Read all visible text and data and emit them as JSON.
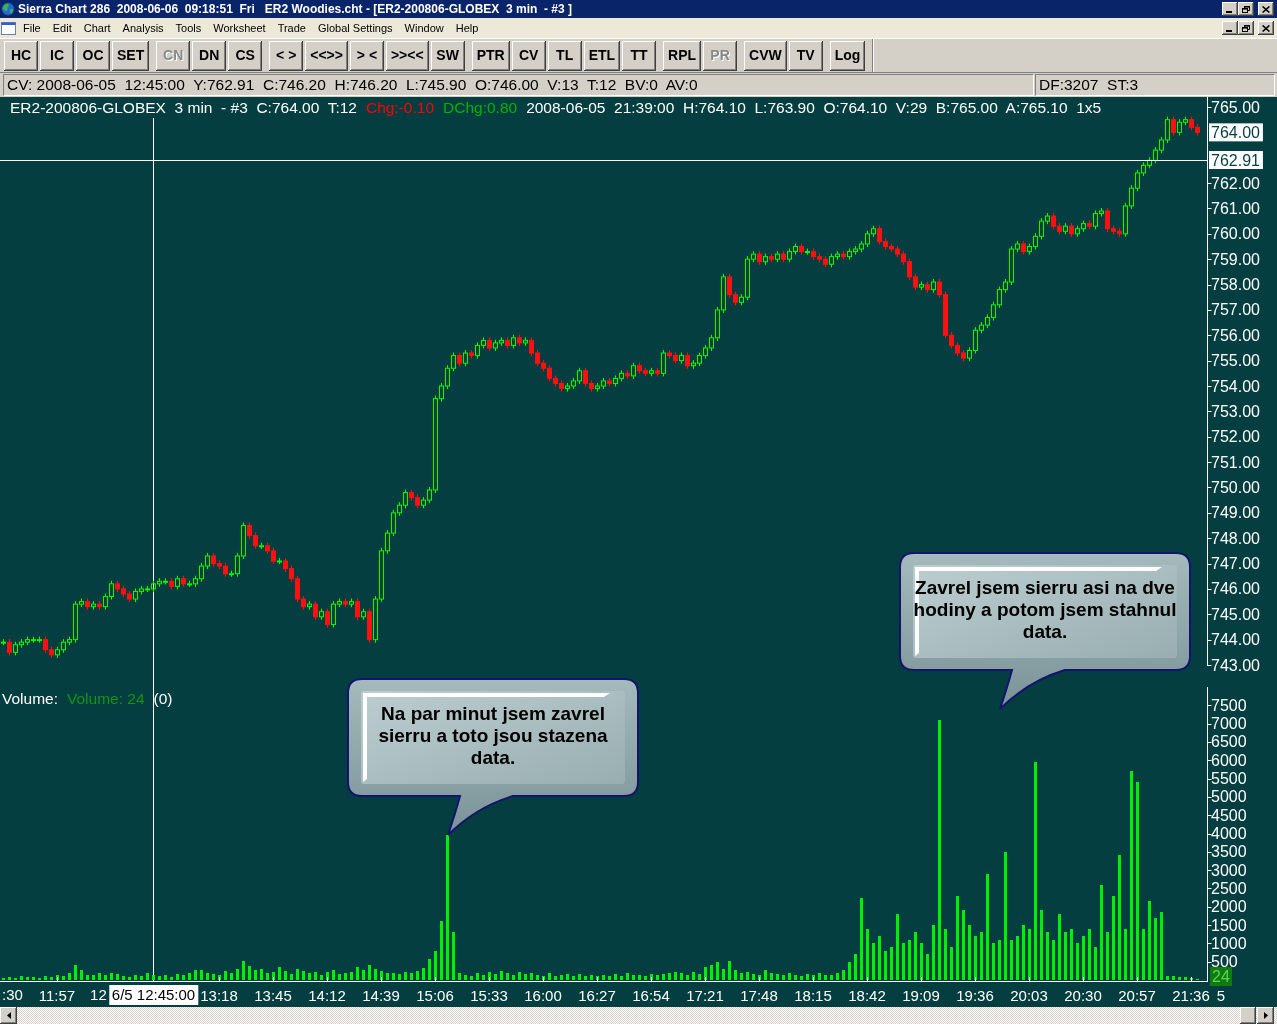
{
  "title_bar": {
    "title": "Sierra Chart 286  2008-06-06  09:18:51  Fri   ER2 Woodies.cht - [ER2-200806-GLOBEX  3 min  - #3 ]"
  },
  "menu_bar": {
    "items": [
      "File",
      "Edit",
      "Chart",
      "Analysis",
      "Tools",
      "Worksheet",
      "Trade",
      "Global Settings",
      "Window",
      "Help"
    ]
  },
  "toolbar": {
    "groups": [
      [
        {
          "label": "HC",
          "disabled": false
        },
        {
          "label": "IC",
          "disabled": false
        },
        {
          "label": "OC",
          "disabled": false
        },
        {
          "label": "SET",
          "disabled": false
        }
      ],
      [
        {
          "label": "CN",
          "disabled": true
        },
        {
          "label": "DN",
          "disabled": false
        },
        {
          "label": "CS",
          "disabled": false
        }
      ],
      [
        {
          "label": "< >",
          "disabled": false
        },
        {
          "label": "<<>>",
          "disabled": false
        },
        {
          "label": "> <",
          "disabled": false
        },
        {
          "label": ">><<",
          "disabled": false
        },
        {
          "label": "SW",
          "disabled": false
        }
      ],
      [
        {
          "label": "PTR",
          "disabled": false
        },
        {
          "label": "CV",
          "disabled": false
        },
        {
          "label": "TL",
          "disabled": false
        },
        {
          "label": "ETL",
          "disabled": false
        },
        {
          "label": "TT",
          "disabled": false
        }
      ],
      [
        {
          "label": "RPL",
          "disabled": false
        },
        {
          "label": "PR",
          "disabled": true
        }
      ],
      [
        {
          "label": "CVW",
          "disabled": false
        },
        {
          "label": "TV",
          "disabled": false
        }
      ],
      [
        {
          "label": "Log",
          "disabled": false
        }
      ]
    ]
  },
  "status_bar": {
    "cursor_values": "CV: 2008-06-05  12:45:00  Y:762.91  C:746.20  H:746.20  L:745.90  O:746.00  V:13  T:12  BV:0  AV:0",
    "feed_status": "DF:3207  ST:3"
  },
  "chart": {
    "header": [
      {
        "text": "ER2-200806-GLOBEX  3 min  - #3  C:764.00  T:12",
        "kind": "info"
      },
      {
        "text": "Chg:-0.10",
        "kind": "negative"
      },
      {
        "text": "DChg:0.80",
        "kind": "positive"
      },
      {
        "text": "2008-06-05  21:39:00  H:764.10  L:763.90  O:764.10  V:29  B:765.00  A:765.10  1x5",
        "kind": "info"
      }
    ],
    "price_axis": [
      {
        "text": "765.00",
        "kind": "tick"
      },
      {
        "text": "764.00",
        "kind": "last_price"
      },
      {
        "text": "762.91",
        "kind": "cursor"
      },
      {
        "text": "762.00",
        "kind": "tick"
      },
      {
        "text": "761.00",
        "kind": "tick"
      },
      {
        "text": "760.00",
        "kind": "tick"
      },
      {
        "text": "759.00",
        "kind": "tick"
      },
      {
        "text": "758.00",
        "kind": "tick"
      },
      {
        "text": "757.00",
        "kind": "tick"
      },
      {
        "text": "756.00",
        "kind": "tick"
      },
      {
        "text": "755.00",
        "kind": "tick"
      },
      {
        "text": "754.00",
        "kind": "tick"
      },
      {
        "text": "753.00",
        "kind": "tick"
      },
      {
        "text": "752.00",
        "kind": "tick"
      },
      {
        "text": "751.00",
        "kind": "tick"
      },
      {
        "text": "750.00",
        "kind": "tick"
      },
      {
        "text": "749.00",
        "kind": "tick"
      },
      {
        "text": "748.00",
        "kind": "tick"
      },
      {
        "text": "747.00",
        "kind": "tick"
      },
      {
        "text": "746.00",
        "kind": "tick"
      },
      {
        "text": "745.00",
        "kind": "tick"
      },
      {
        "text": "744.00",
        "kind": "tick"
      },
      {
        "text": "743.00",
        "kind": "tick"
      }
    ],
    "volume_legend": [
      {
        "text": "Volume:",
        "kind": "label"
      },
      {
        "text": "Volume: 24",
        "kind": "study"
      },
      {
        "text": "(0)",
        "kind": "label"
      }
    ],
    "volume_chart": {
      "chart_data": {
        "type": "bar",
        "categories": [
          null,
          null,
          null,
          null,
          null,
          null,
          null,
          null,
          null,
          "11:57",
          null,
          null,
          null,
          null,
          null,
          null,
          null,
          null,
          null,
          null,
          null,
          null,
          null,
          null,
          null,
          null,
          null,
          null,
          null,
          null,
          null,
          null,
          null,
          null,
          null,
          null,
          "13:18",
          null,
          null,
          null,
          null,
          null,
          null,
          null,
          null,
          "13:45",
          null,
          null,
          null,
          null,
          null,
          null,
          null,
          null,
          "14:12",
          null,
          null,
          null,
          null,
          null,
          null,
          null,
          null,
          "14:39",
          null,
          null,
          null,
          null,
          null,
          null,
          null,
          null,
          "15:06",
          null,
          null,
          null,
          null,
          null,
          null,
          null,
          null,
          "15:33",
          null,
          null,
          null,
          null,
          null,
          null,
          null,
          null,
          "16:00",
          null,
          null,
          null,
          null,
          null,
          null,
          null,
          null,
          "16:27",
          null,
          null,
          null,
          null,
          null,
          null,
          null,
          null,
          "16:54",
          null,
          null,
          null,
          null,
          null,
          null,
          null,
          null,
          "17:21",
          null,
          null,
          null,
          null,
          null,
          null,
          null,
          null,
          "17:48",
          null,
          null,
          null,
          null,
          null,
          null,
          null,
          null,
          "18:15",
          null,
          null,
          null,
          null,
          null,
          null,
          null,
          null,
          "18:42",
          null,
          null,
          null,
          null,
          null,
          null,
          null,
          null,
          "19:09",
          null,
          null,
          null,
          null,
          null,
          null,
          null,
          null,
          "19:36",
          null,
          null,
          null,
          null,
          null,
          null,
          null,
          null,
          "20:03",
          null,
          null,
          null,
          null,
          null,
          null,
          null,
          null,
          "20:30",
          null,
          null,
          null,
          null,
          null,
          null,
          null,
          null,
          "20:57",
          null,
          null,
          null,
          null,
          null,
          null,
          null,
          null,
          "21:36",
          null,
          null,
          null,
          null,
          "5"
        ],
        "series": [
          {
            "color": "#00f000",
            "values": [
              60,
              80,
              50,
              120,
              70,
              90,
              60,
              100,
              80,
              150,
              120,
              180,
              420,
              260,
              150,
              130,
              200,
              140,
              180,
              160,
              110,
              90,
              150,
              120,
              180,
              140,
              100,
              130,
              90,
              160,
              150,
              200,
              280,
              260,
              190,
              170,
              140,
              250,
              180,
              300,
              520,
              380,
              260,
              300,
              190,
              210,
              360,
              240,
              160,
              300,
              250,
              180,
              230,
              140,
              210,
              260,
              170,
              190,
              230,
              360,
              280,
              400,
              310,
              250,
              200,
              180,
              170,
              220,
              190,
              240,
              330,
              560,
              800,
              1600,
              3950,
              1300,
              200,
              150,
              120,
              200,
              150,
              220,
              170,
              250,
              180,
              140,
              210,
              160,
              190,
              150,
              120,
              180,
              100,
              140,
              170,
              120,
              160,
              110,
              130,
              100,
              140,
              110,
              160,
              120,
              180,
              130,
              150,
              110,
              170,
              140,
              160,
              200,
              230,
              180,
              150,
              210,
              170,
              350,
              420,
              500,
              300,
              520,
              260,
              180,
              210,
              170,
              150,
              260,
              190,
              170,
              140,
              190,
              150,
              120,
              160,
              140,
              180,
              150,
              130,
              200,
              280,
              500,
              700,
              2250,
              1400,
              1000,
              1200,
              800,
              900,
              1800,
              1000,
              1100,
              1300,
              1000,
              700,
              1500,
              7100,
              1400,
              900,
              2300,
              1900,
              1500,
              1200,
              1300,
              2900,
              1000,
              1100,
              3500,
              1100,
              1200,
              1500,
              1400,
              5950,
              1900,
              1300,
              1100,
              1800,
              1300,
              1400,
              1000,
              1200,
              1400,
              900,
              2600,
              1300,
              2300,
              3400,
              1400,
              5700,
              5400,
              1400,
              2150,
              1700,
              1850,
              100,
              120,
              80,
              90,
              60,
              24,
              null,
              null,
              null,
              null
            ]
          }
        ],
        "ylim": [
          0,
          8000
        ],
        "yticks": [
          500,
          1000,
          1500,
          2000,
          2500,
          3000,
          3500,
          4000,
          4500,
          5000,
          5500,
          6000,
          6500,
          7000,
          7500
        ]
      }
    },
    "time_axis_fragments": [
      ":30",
      "12"
    ],
    "volume_axis_marker": "24",
    "time_cursor": "6/5 12:45:00",
    "callouts": [
      {
        "text": "Na par minut jsem zavrel sierru a toto jsou stazena data."
      },
      {
        "text": "Zavrel jsem sierru asi na dve hodiny a potom jsem stahnul data."
      }
    ]
  }
}
